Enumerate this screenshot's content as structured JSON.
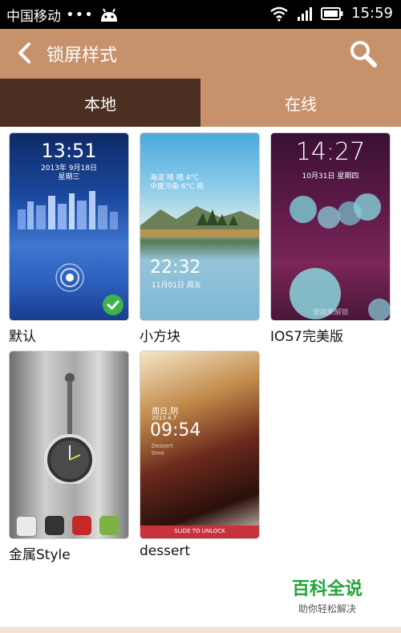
{
  "status_bar": {
    "carrier": "中国移动",
    "dots": "•••",
    "time": "15:59"
  },
  "header": {
    "title": "锁屏样式"
  },
  "tabs": [
    {
      "label": "本地",
      "active": true
    },
    {
      "label": "在线",
      "active": false
    }
  ],
  "themes": [
    {
      "label": "默认",
      "time": "13:51",
      "date": "2013年 9月18日",
      "weekday": "星期三",
      "selected": true
    },
    {
      "label": "小方块",
      "weather1": "海淀 晴 晴 4°C",
      "weather2": "中度污染 6°C 雨",
      "time": "22:32",
      "date": "11月01日 周五"
    },
    {
      "label": "IOS7完美版",
      "time": "14:27",
      "date": "10月31日 星期四",
      "hint": "滑动来解锁"
    },
    {
      "label": "金属Style"
    },
    {
      "label": "dessert",
      "weekday": "周日,阴",
      "date": "2013.4.7",
      "time": "09:54",
      "sub1": "Dessert",
      "sub2": "time",
      "unlock": "SLIDE TO UNLOCK"
    }
  ],
  "watermark": {
    "main": "百科全说",
    "sub": "助你轻松解决"
  },
  "colors": {
    "header": "#c7916c",
    "tab_active": "#4b2f20",
    "check": "#3bb34a"
  }
}
